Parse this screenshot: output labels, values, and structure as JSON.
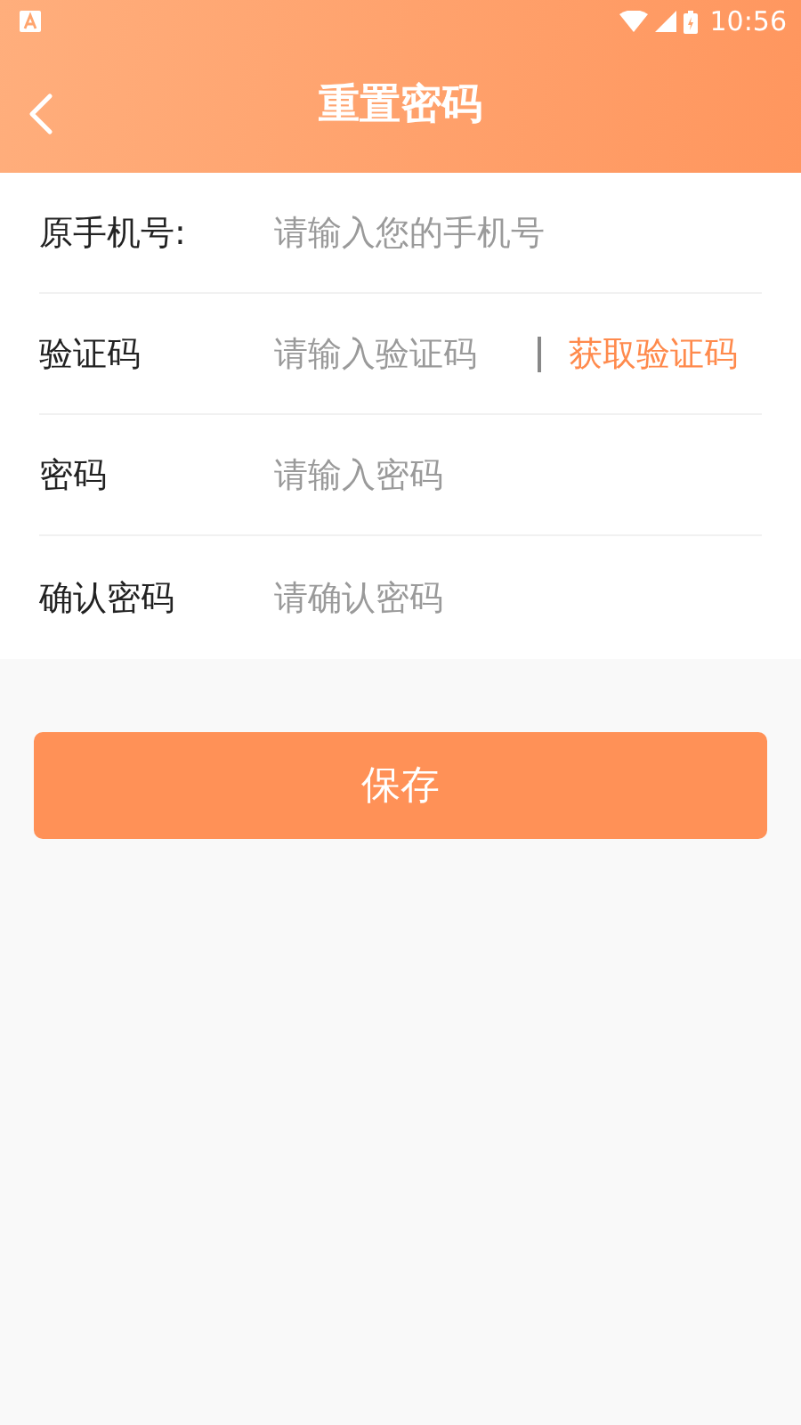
{
  "status_bar": {
    "time": "10:56"
  },
  "header": {
    "title": "重置密码"
  },
  "fields": [
    {
      "kind": "text",
      "label": "原手机号:",
      "placeholder": "请输入您的手机号"
    },
    {
      "kind": "code",
      "label": "验证码",
      "placeholder": "请输入验证码",
      "action": "获取验证码"
    },
    {
      "kind": "text",
      "label": "密码",
      "placeholder": "请输入密码"
    },
    {
      "kind": "text",
      "label": "确认密码",
      "placeholder": "请确认密码"
    }
  ],
  "save_button": "保存"
}
